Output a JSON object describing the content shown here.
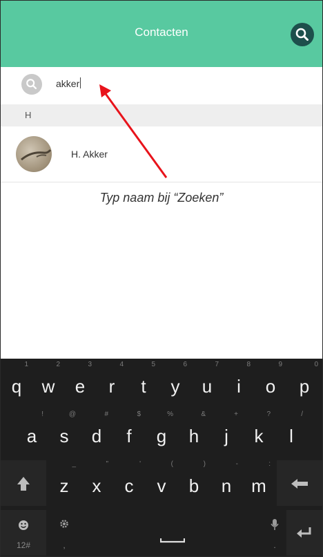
{
  "header": {
    "title": "Contacten",
    "search_icon": "search-icon"
  },
  "search": {
    "value": "akker"
  },
  "section": {
    "letter": "H"
  },
  "contact": {
    "name": "H. Akker"
  },
  "annotation": {
    "text": "Typ naam bij “Zoeken”",
    "color": "#e8131b"
  },
  "colors": {
    "header": "#58c9a0",
    "header_button": "#1d4f4c",
    "keyboard": "#1e1e1e"
  },
  "keyboard": {
    "row1": [
      {
        "key": "q",
        "hint": "1"
      },
      {
        "key": "w",
        "hint": "2"
      },
      {
        "key": "e",
        "hint": "3"
      },
      {
        "key": "r",
        "hint": "4"
      },
      {
        "key": "t",
        "hint": "5"
      },
      {
        "key": "y",
        "hint": "6"
      },
      {
        "key": "u",
        "hint": "7"
      },
      {
        "key": "i",
        "hint": "8"
      },
      {
        "key": "o",
        "hint": "9"
      },
      {
        "key": "p",
        "hint": "0"
      }
    ],
    "row2": [
      {
        "key": "a",
        "hint": "!"
      },
      {
        "key": "s",
        "hint": "@"
      },
      {
        "key": "d",
        "hint": "#"
      },
      {
        "key": "f",
        "hint": "$"
      },
      {
        "key": "g",
        "hint": "%"
      },
      {
        "key": "h",
        "hint": "&"
      },
      {
        "key": "j",
        "hint": "+"
      },
      {
        "key": "k",
        "hint": "?"
      },
      {
        "key": "l",
        "hint": "/"
      }
    ],
    "row3": [
      {
        "key": "z",
        "hint": "_"
      },
      {
        "key": "x",
        "hint": "\""
      },
      {
        "key": "c",
        "hint": "'"
      },
      {
        "key": "v",
        "hint": "("
      },
      {
        "key": "b",
        "hint": ")"
      },
      {
        "key": "n",
        "hint": "-"
      },
      {
        "key": "m",
        "hint": ":"
      }
    ],
    "row4": {
      "symbols_label": "12#",
      "comma": ",",
      "period": "."
    }
  }
}
